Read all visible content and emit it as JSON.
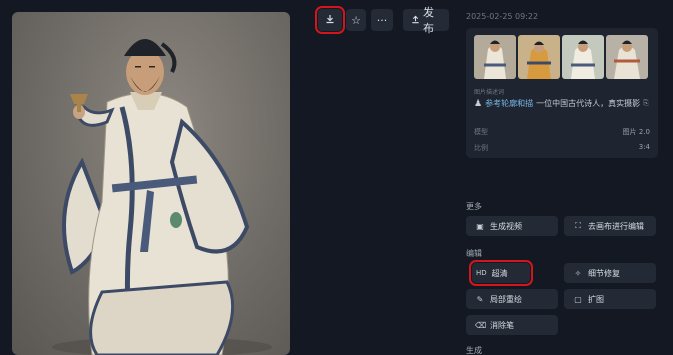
{
  "toolbar": {
    "download_icon": "download-icon",
    "favorite_icon": "star-icon",
    "more_label": "···",
    "publish_label": "发布"
  },
  "timestamp": "2025-02-25 09:22",
  "info": {
    "description_label": "图片描述词",
    "description_prefix": "参考轮廓和描",
    "description_rest": "一位中国古代诗人，真实摄影",
    "model_label": "模型",
    "model_value": "图片 2.0",
    "ratio_label": "比例",
    "ratio_value": "3:4"
  },
  "sections": {
    "more_title": "更多",
    "edit_title": "编辑",
    "generate_title": "生成"
  },
  "actions": {
    "generate_video": "生成视频",
    "canvas_edit": "去画布进行编辑",
    "hd_badge": "HD",
    "super_resolution": "超清",
    "detail_repair": "细节修复",
    "local_redraw": "局部重绘",
    "expand": "扩图",
    "eraser": "消除笔"
  },
  "colors": {
    "background": "#131822",
    "highlight": "#d2161c",
    "button": "#242a35"
  }
}
